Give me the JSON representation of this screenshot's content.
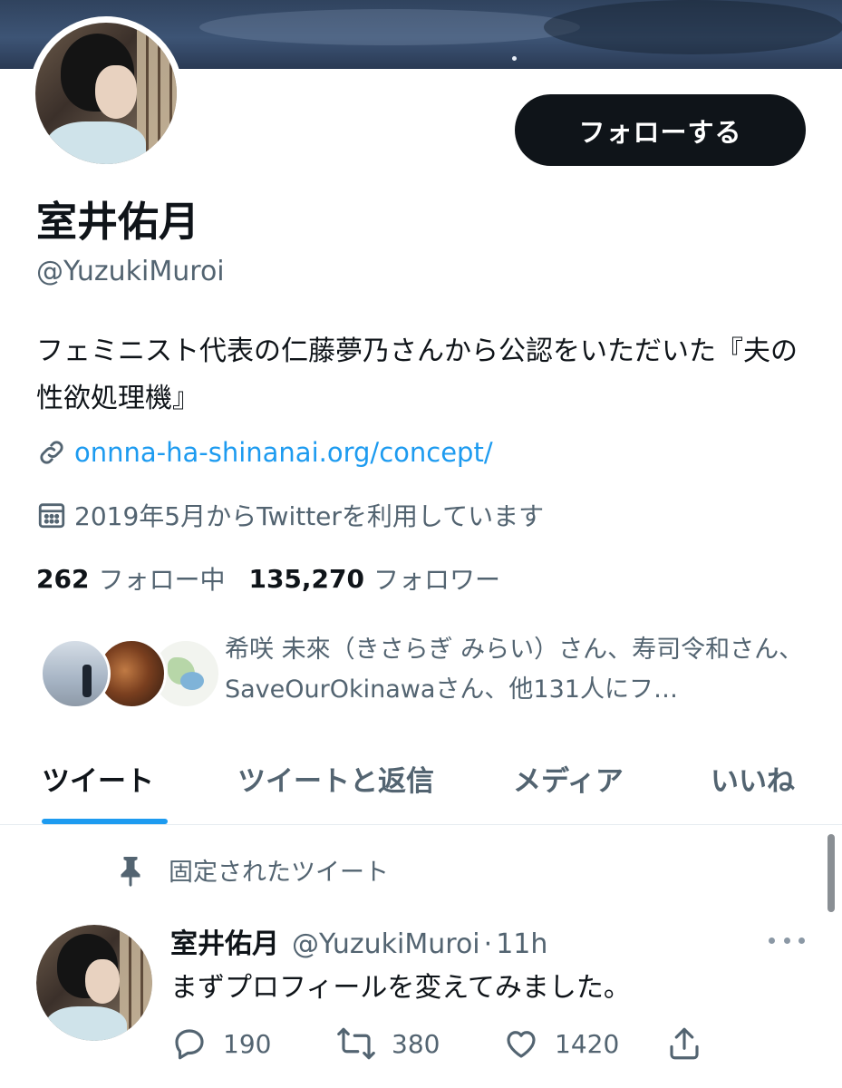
{
  "profile": {
    "name": "室井佑月",
    "handle": "@YuzukiMuroi",
    "bio": "フェミニスト代表の仁藤夢乃さんから公認をいただいた『夫の性欲処理機』",
    "link": "onnna-ha-shinanai.org/concept/",
    "joined": "2019年5月からTwitterを利用しています",
    "following_count": "262",
    "following_label": "フォロー中",
    "followers_count": "135,270",
    "followers_label": "フォロワー",
    "followed_by_text": "希咲 未來（きさらぎ みらい）さん、寿司令和さん、SaveOurOkinawaさん、他131人にフ…",
    "follow_button_label": "フォローする"
  },
  "tabs": [
    {
      "label": "ツイート",
      "active": true
    },
    {
      "label": "ツイートと返信",
      "active": false
    },
    {
      "label": "メディア",
      "active": false
    },
    {
      "label": "いいね",
      "active": false
    }
  ],
  "pinned_tweet": {
    "pinned_label": "固定されたツイート",
    "author_name": "室井佑月",
    "author_handle": "@YuzukiMuroi",
    "separator": "·",
    "time": "11h",
    "text": "まずプロフィールを変えてみました。",
    "reply_count": "190",
    "retweet_count": "380",
    "like_count": "1420"
  },
  "icons": {
    "link": "link-icon",
    "calendar": "calendar-icon",
    "pin": "pin-icon",
    "reply": "reply-icon",
    "retweet": "retweet-icon",
    "like": "heart-icon",
    "share": "share-icon",
    "more": "more-icon"
  },
  "colors": {
    "accent": "#1d9bf0",
    "text_primary": "#0f1419",
    "text_secondary": "#536471",
    "follow_button_bg": "#0f1419"
  }
}
